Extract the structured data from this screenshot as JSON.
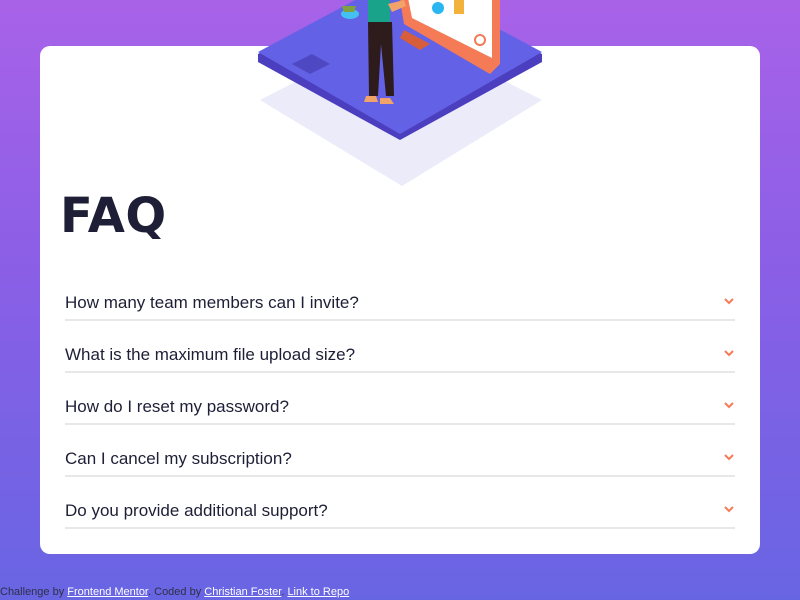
{
  "colors": {
    "background_top": "#a862e8",
    "background_bottom": "#6865e3",
    "card": "#ffffff",
    "text": "#1e1f36",
    "accent": "#f47b56",
    "divider": "#e8e8ea",
    "link": "#ffffff"
  },
  "faq": {
    "title": "FAQ",
    "items": [
      {
        "question": "How many team members can I invite?",
        "icon": "chevron-down-icon"
      },
      {
        "question": "What is the maximum file upload size?",
        "icon": "chevron-down-icon"
      },
      {
        "question": "How do I reset my password?",
        "icon": "chevron-down-icon"
      },
      {
        "question": "Can I cancel my subscription?",
        "icon": "chevron-down-icon"
      },
      {
        "question": "Do you provide additional support?",
        "icon": "chevron-down-icon"
      }
    ]
  },
  "footer": {
    "challenge_text": "Challenge by",
    "challenge_link": "Frontend Mentor",
    "coded_text": "Coded by",
    "author_link": "Christian Foster",
    "repo_link": "Link to Repo"
  }
}
